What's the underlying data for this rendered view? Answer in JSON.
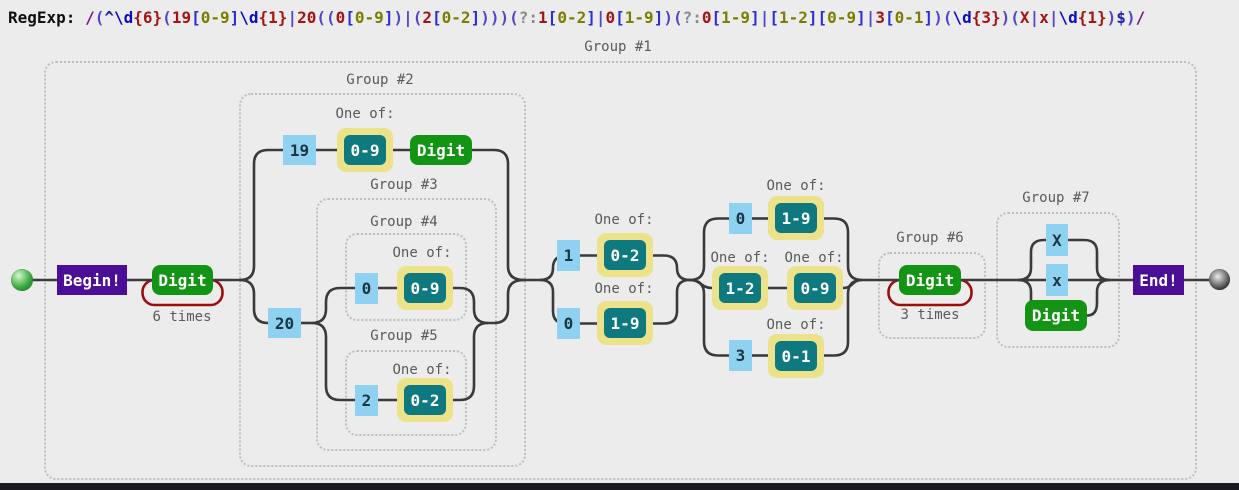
{
  "regexp": {
    "label": "RegExp:",
    "pattern": "/(^\\d{6}(19[0-9]\\d{1}|20((0[0-9])|(2[0-2])))(?:1[0-2]|0[1-9])(?:0[1-9]|[1-2][0-9]|3[0-1])(\\d{3})(X|x|\\d{1})$)/",
    "tokens": [
      {
        "t": "/",
        "c": "slash"
      },
      {
        "t": "(",
        "c": "paren"
      },
      {
        "t": "^",
        "c": "anchor"
      },
      {
        "t": "\\d",
        "c": "escape"
      },
      {
        "t": "{6}",
        "c": "quant"
      },
      {
        "t": "(",
        "c": "paren"
      },
      {
        "t": "19",
        "c": "literal"
      },
      {
        "t": "[",
        "c": "bracket"
      },
      {
        "t": "0-9",
        "c": "class"
      },
      {
        "t": "]",
        "c": "bracket"
      },
      {
        "t": "\\d",
        "c": "escape"
      },
      {
        "t": "{1}",
        "c": "quant"
      },
      {
        "t": "|",
        "c": "paren"
      },
      {
        "t": "20",
        "c": "literal"
      },
      {
        "t": "(",
        "c": "paren"
      },
      {
        "t": "(",
        "c": "paren"
      },
      {
        "t": "0",
        "c": "literal"
      },
      {
        "t": "[",
        "c": "bracket"
      },
      {
        "t": "0-9",
        "c": "class"
      },
      {
        "t": "]",
        "c": "bracket"
      },
      {
        "t": ")",
        "c": "paren"
      },
      {
        "t": "|",
        "c": "paren"
      },
      {
        "t": "(",
        "c": "paren"
      },
      {
        "t": "2",
        "c": "literal"
      },
      {
        "t": "[",
        "c": "bracket"
      },
      {
        "t": "0-2",
        "c": "class"
      },
      {
        "t": "]",
        "c": "bracket"
      },
      {
        "t": ")",
        "c": "paren"
      },
      {
        "t": ")",
        "c": "paren"
      },
      {
        "t": ")",
        "c": "paren"
      },
      {
        "t": "(",
        "c": "paren"
      },
      {
        "t": "?:",
        "c": "groupmod"
      },
      {
        "t": "1",
        "c": "literal"
      },
      {
        "t": "[",
        "c": "bracket"
      },
      {
        "t": "0-2",
        "c": "class"
      },
      {
        "t": "]",
        "c": "bracket"
      },
      {
        "t": "|",
        "c": "paren"
      },
      {
        "t": "0",
        "c": "literal"
      },
      {
        "t": "[",
        "c": "bracket"
      },
      {
        "t": "1-9",
        "c": "class"
      },
      {
        "t": "]",
        "c": "bracket"
      },
      {
        "t": ")",
        "c": "paren"
      },
      {
        "t": "(",
        "c": "paren"
      },
      {
        "t": "?:",
        "c": "groupmod"
      },
      {
        "t": "0",
        "c": "literal"
      },
      {
        "t": "[",
        "c": "bracket"
      },
      {
        "t": "1-9",
        "c": "class"
      },
      {
        "t": "]",
        "c": "bracket"
      },
      {
        "t": "|",
        "c": "paren"
      },
      {
        "t": "[",
        "c": "bracket"
      },
      {
        "t": "1-2",
        "c": "class"
      },
      {
        "t": "]",
        "c": "bracket"
      },
      {
        "t": "[",
        "c": "bracket"
      },
      {
        "t": "0-9",
        "c": "class"
      },
      {
        "t": "]",
        "c": "bracket"
      },
      {
        "t": "|",
        "c": "paren"
      },
      {
        "t": "3",
        "c": "literal"
      },
      {
        "t": "[",
        "c": "bracket"
      },
      {
        "t": "0-1",
        "c": "class"
      },
      {
        "t": "]",
        "c": "bracket"
      },
      {
        "t": ")",
        "c": "paren"
      },
      {
        "t": "(",
        "c": "paren"
      },
      {
        "t": "\\d",
        "c": "escape"
      },
      {
        "t": "{3}",
        "c": "quant"
      },
      {
        "t": ")",
        "c": "paren"
      },
      {
        "t": "(",
        "c": "paren"
      },
      {
        "t": "X",
        "c": "literal"
      },
      {
        "t": "|",
        "c": "paren"
      },
      {
        "t": "x",
        "c": "literal"
      },
      {
        "t": "|",
        "c": "paren"
      },
      {
        "t": "\\d",
        "c": "escape"
      },
      {
        "t": "{1}",
        "c": "quant"
      },
      {
        "t": ")",
        "c": "paren"
      },
      {
        "t": "$",
        "c": "anchor"
      },
      {
        "t": ")",
        "c": "paren"
      },
      {
        "t": "/",
        "c": "slash"
      }
    ]
  },
  "groups": {
    "g1": "Group #1",
    "g2": "Group #2",
    "g3": "Group #3",
    "g4": "Group #4",
    "g5": "Group #5",
    "g6": "Group #6",
    "g7": "Group #7"
  },
  "labels": {
    "one_of": "One of:",
    "six_times": "6 times",
    "three_times": "3 times"
  },
  "nodes": {
    "begin": "Begin!",
    "end": "End!",
    "digit1": "Digit",
    "digit2": "Digit",
    "digit3": "Digit",
    "digit4": "Digit",
    "lit19": "19",
    "lit20": "20",
    "lit0a": "0",
    "lit2": "2",
    "lit1": "1",
    "lit0b": "0",
    "lit0c": "0",
    "lit3": "3",
    "litX": "X",
    "litx": "x",
    "cls09a": "0-9",
    "cls09b": "0-9",
    "cls02a": "0-2",
    "cls02b": "0-2",
    "cls19a": "1-9",
    "cls19b": "1-9",
    "cls12": "1-2",
    "cls09c": "0-9",
    "cls01": "0-1"
  },
  "colors": {
    "background": "#ececec",
    "anchor_purple": "#4a0e97",
    "meta_green": "#149414",
    "literal_blue": "#8ed1f0",
    "charclass_teal": "#0e7a80",
    "charclass_yellow": "#ece289",
    "repeat_red": "#9b0d0d",
    "wire_gray": "#3a3a3a"
  }
}
